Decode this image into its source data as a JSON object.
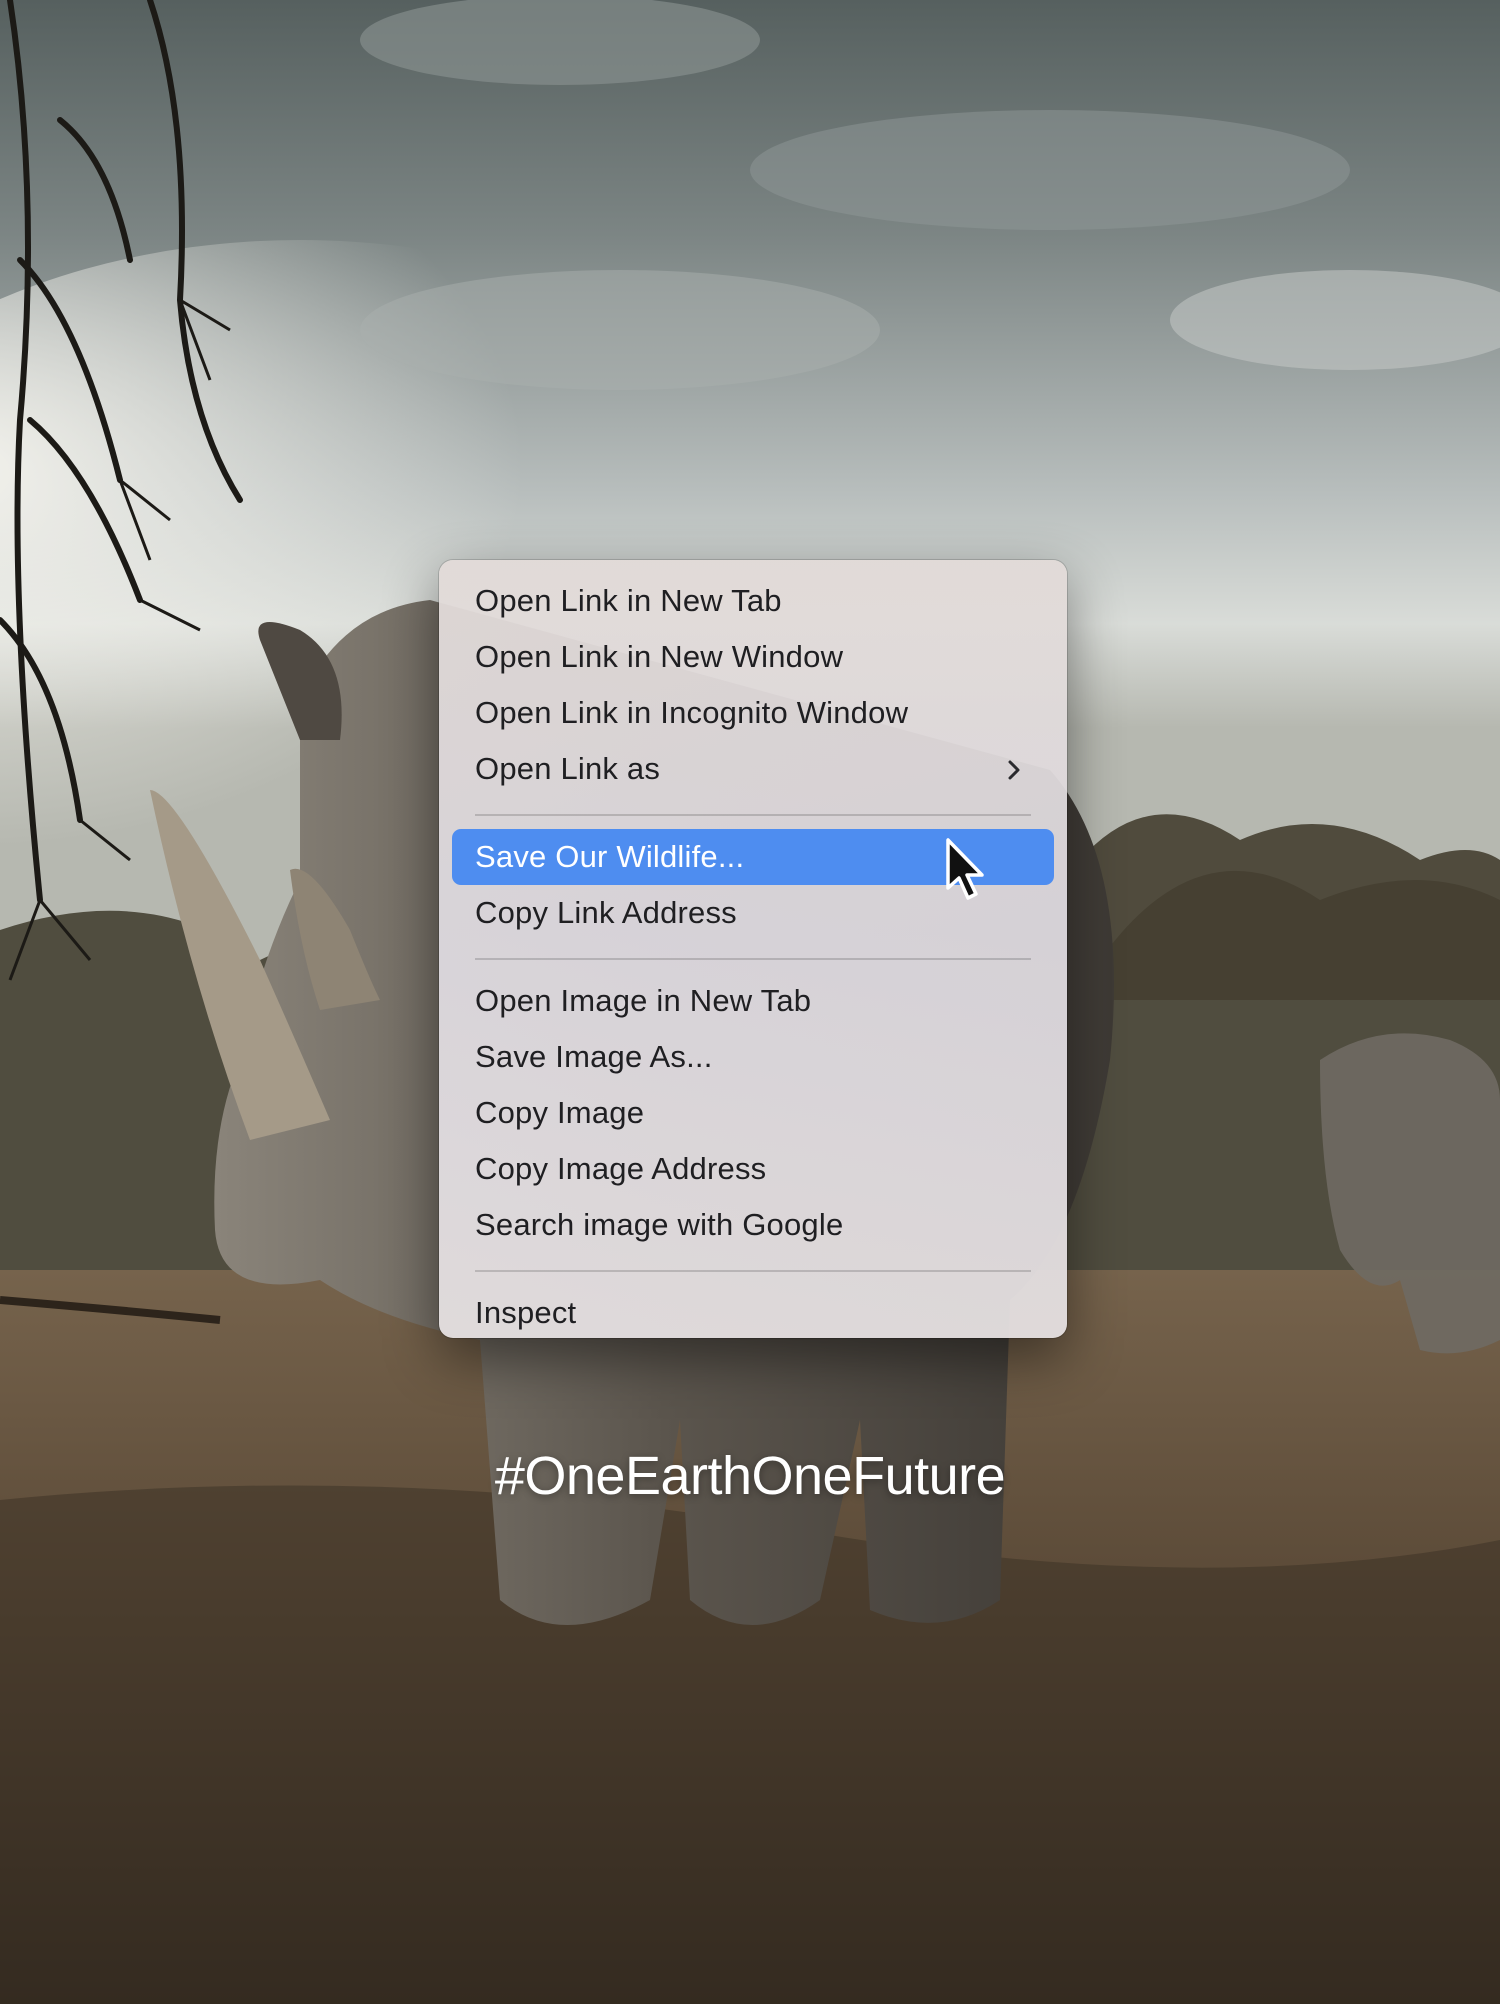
{
  "background": {
    "description_icon": "rhino-photo",
    "sky_color": "#9aa3a4",
    "ground_color": "#6b5a45"
  },
  "context_menu": {
    "groups": [
      {
        "items": [
          {
            "label": "Open Link in New Tab"
          },
          {
            "label": "Open Link in New Window"
          },
          {
            "label": "Open Link in Incognito Window"
          },
          {
            "label": "Open Link as",
            "has_submenu": true,
            "icon": "chevron-right-icon"
          }
        ]
      },
      {
        "items": [
          {
            "label": "Save Our Wildlife...",
            "highlighted": true
          },
          {
            "label": "Copy Link Address"
          }
        ]
      },
      {
        "items": [
          {
            "label": "Open Image in New Tab"
          },
          {
            "label": "Save Image As..."
          },
          {
            "label": "Copy Image"
          },
          {
            "label": "Copy Image Address"
          },
          {
            "label": "Search image with Google"
          }
        ]
      },
      {
        "items": [
          {
            "label": "Inspect"
          }
        ]
      }
    ],
    "highlight_color": "#4e8df0"
  },
  "cursor": {
    "icon": "arrow-cursor-icon"
  },
  "hashtag": "#OneEarthOneFuture"
}
